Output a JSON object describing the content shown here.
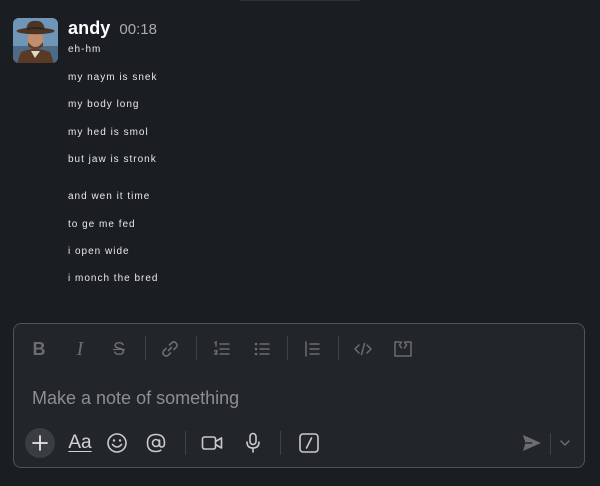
{
  "message": {
    "author": "andy",
    "timestamp": "00:18",
    "avatar_colors": {
      "sky": "#6f95b7",
      "hat": "#4a3424",
      "face": "#c08d6f",
      "shirt": "#5a3a25"
    },
    "lines": [
      "eh-hm",
      "my naym is snek",
      "my body long",
      "my hed is smol",
      "but jaw is stronk",
      "and wen it time",
      "to ge me fed",
      "i open wide",
      "i monch the bred"
    ]
  },
  "composer": {
    "placeholder": "Make a note of something",
    "format_toolbar": {
      "bold_label": "B",
      "italic_label": "I",
      "strike_label": "S",
      "buttons": [
        "bold",
        "italic",
        "strikethrough",
        "link",
        "ordered-list",
        "bulleted-list",
        "blockquote",
        "code",
        "code-block"
      ]
    },
    "bottom_toolbar": {
      "text_format_label": "Aa",
      "buttons": [
        "add",
        "text-formatting",
        "emoji",
        "mention",
        "video",
        "audio",
        "shortcuts",
        "send",
        "send-options"
      ]
    }
  },
  "colors": {
    "background": "#1a1d21",
    "composer_background": "#222529",
    "composer_border": "#4f5257",
    "author_text": "#ffffff",
    "timestamp_text": "#ababad",
    "toolbar_icon": "#6b6d70"
  }
}
